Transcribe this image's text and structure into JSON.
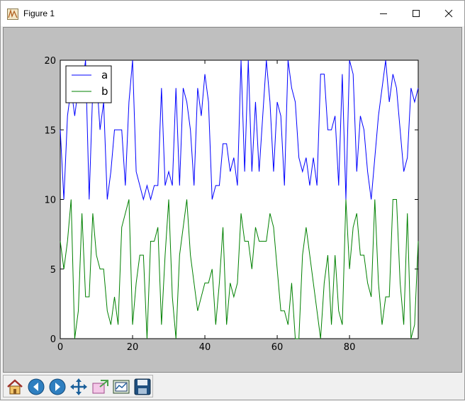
{
  "window": {
    "title": "Figure 1"
  },
  "toolbar": {
    "buttons": [
      {
        "name": "home-button",
        "icon": "home-icon"
      },
      {
        "name": "back-button",
        "icon": "back-arrow-icon"
      },
      {
        "name": "forward-button",
        "icon": "forward-arrow-icon"
      },
      {
        "name": "pan-button",
        "icon": "pan-arrows-icon"
      },
      {
        "name": "zoom-button",
        "icon": "zoom-rect-icon"
      },
      {
        "name": "configure-subplots-button",
        "icon": "subplots-icon"
      },
      {
        "name": "save-button",
        "icon": "save-disk-icon"
      }
    ]
  },
  "colors": {
    "series_a": "#0000ff",
    "series_b": "#008000",
    "figure_bg": "#bfbfbf",
    "axes_bg": "#ffffff"
  },
  "chart_data": {
    "type": "line",
    "title": "",
    "xlabel": "",
    "ylabel": "",
    "xlim": [
      0,
      99
    ],
    "ylim": [
      0,
      20
    ],
    "xticks": [
      "0",
      "20",
      "40",
      "60",
      "80"
    ],
    "yticks": [
      "0",
      "5",
      "10",
      "15",
      "20"
    ],
    "grid": false,
    "legend_position": "top-left",
    "x": [
      0,
      1,
      2,
      3,
      4,
      5,
      6,
      7,
      8,
      9,
      10,
      11,
      12,
      13,
      14,
      15,
      16,
      17,
      18,
      19,
      20,
      21,
      22,
      23,
      24,
      25,
      26,
      27,
      28,
      29,
      30,
      31,
      32,
      33,
      34,
      35,
      36,
      37,
      38,
      39,
      40,
      41,
      42,
      43,
      44,
      45,
      46,
      47,
      48,
      49,
      50,
      51,
      52,
      53,
      54,
      55,
      56,
      57,
      58,
      59,
      60,
      61,
      62,
      63,
      64,
      65,
      66,
      67,
      68,
      69,
      70,
      71,
      72,
      73,
      74,
      75,
      76,
      77,
      78,
      79,
      80,
      81,
      82,
      83,
      84,
      85,
      86,
      87,
      88,
      89,
      90,
      91,
      92,
      93,
      94,
      95,
      96,
      97,
      98,
      99
    ],
    "series": [
      {
        "name": "a",
        "color": "#0000ff",
        "values": [
          15,
          10,
          16,
          18,
          16,
          18,
          18,
          20,
          10,
          18,
          19,
          15,
          17,
          10,
          12,
          15,
          15,
          15,
          11,
          17,
          20,
          12,
          11,
          10,
          11,
          10,
          11,
          11,
          18,
          11,
          12,
          11,
          18,
          11,
          18,
          17,
          15,
          11,
          18,
          16,
          19,
          17,
          10,
          11,
          11,
          14,
          14,
          12,
          13,
          11,
          20,
          12,
          20,
          12,
          17,
          12,
          16,
          20,
          17,
          12,
          17,
          16,
          11,
          20,
          18,
          17,
          13,
          12,
          13,
          11,
          13,
          11,
          19,
          19,
          15,
          15,
          16,
          11,
          19,
          10,
          20,
          19,
          12,
          16,
          15,
          12,
          10,
          13,
          16,
          18,
          20,
          17,
          19,
          18,
          15,
          12,
          13,
          18,
          17,
          18
        ]
      },
      {
        "name": "b",
        "color": "#008000",
        "values": [
          7,
          5,
          7,
          10,
          0,
          2,
          9,
          3,
          3,
          9,
          6,
          5,
          5,
          2,
          1,
          3,
          1,
          8,
          9,
          10,
          1,
          4,
          6,
          6,
          0,
          7,
          7,
          8,
          1,
          6,
          10,
          3,
          0,
          6,
          8,
          10,
          6,
          4,
          2,
          3,
          4,
          4,
          5,
          1,
          4,
          8,
          1,
          4,
          3,
          4,
          9,
          7,
          7,
          5,
          8,
          7,
          7,
          7,
          9,
          8,
          5,
          2,
          2,
          1,
          4,
          0,
          0,
          6,
          8,
          6,
          4,
          2,
          0,
          4,
          6,
          1,
          6,
          2,
          1,
          10,
          5,
          8,
          9,
          6,
          6,
          4,
          3,
          10,
          4,
          1,
          3,
          3,
          10,
          10,
          4,
          1,
          9,
          0,
          1,
          7
        ]
      }
    ]
  }
}
